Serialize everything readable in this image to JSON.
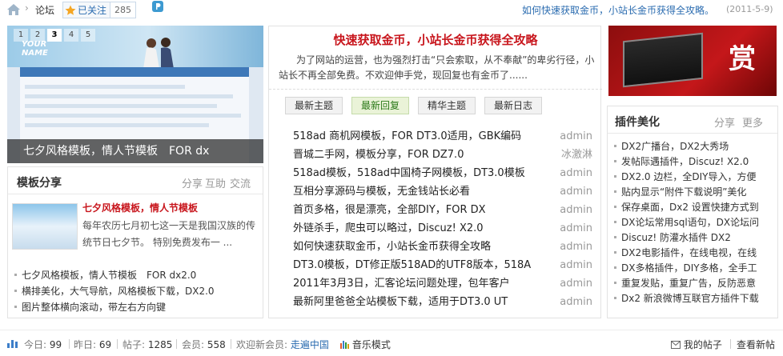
{
  "topbar": {
    "breadcrumb": "论坛",
    "follow_label": "已关注",
    "follow_count": "285",
    "headline_link": "如何快速获取金币，小站长金币获得全攻略。",
    "headline_date": "(2011-5-9)"
  },
  "slideshow": {
    "pages": [
      "1",
      "2",
      "3",
      "4",
      "5"
    ],
    "active_page": "3",
    "caption": "七夕风格模板，情人节模板　FOR dx",
    "logo_text": "YOUR NAME"
  },
  "template_share": {
    "title": "模板分享",
    "tabs": [
      "分享",
      "互助",
      "交流"
    ],
    "feature_title": "七夕风格模板，情人节模板",
    "feature_desc": "每年农历七月初七这一天是我国汉族的传统节日七夕节。 特别免费发布一 ...",
    "items": [
      "七夕风格模板，情人节模板　FOR dx2.0",
      "横排美化，大气导航，风格模板下载，DX2.0",
      "图片整体横向滚动，带左右方向键"
    ]
  },
  "article": {
    "title": "快速获取金币，小站长金币获得全攻略",
    "desc": "为了网站的运营，也为强烈打击“只会索取，从不奉献”的卑劣行径，小站长不再全部免费。不欢迎伸手党，现回复也有金币了......",
    "tabs": [
      "最新主题",
      "最新回复",
      "精华主题",
      "最新日志"
    ],
    "active_tab": "最新回复",
    "threads": [
      {
        "title": "518ad 商机网模板，FOR DT3.0适用，GBK编码",
        "author": "admin"
      },
      {
        "title": "晋城二手网，模板分享，FOR DZ7.0",
        "author": "冰激淋"
      },
      {
        "title": "518ad模板，518ad中国椅子网模板，DT3.0模板",
        "author": "admin"
      },
      {
        "title": "互相分享源码与模板，无金钱站长必看",
        "author": "admin"
      },
      {
        "title": "首页多格，很是漂亮，全部DIY，FOR DX",
        "author": "admin"
      },
      {
        "title": "外链杀手，爬虫可以略过，Discuz! X2.0",
        "author": "admin"
      },
      {
        "title": "如何快速获取金币，小站长金币获得全攻略",
        "author": "admin"
      },
      {
        "title": "DT3.0模板，DT修正版518AD的UTF8版本，518A",
        "author": "admin"
      },
      {
        "title": "2011年3月3日，汇客论坛问题处理，包年客户",
        "author": "admin"
      },
      {
        "title": "最新阿里爸爸全站模板下载，适用于DT3.0 UT",
        "author": "admin"
      }
    ]
  },
  "ad": {
    "text": "赏"
  },
  "plugins": {
    "title": "插件美化",
    "tabs": [
      "分享",
      "更多"
    ],
    "items": [
      "DX2广播台，DX2大秀场",
      "发帖际遇插件，Discuz! X2.0",
      "DX2.0 边栏，全DIY导入，方便",
      "贴内显示“附件下载说明”美化",
      "保存桌面，Dx2 设置快捷方式到",
      "DX论坛常用sql语句，DX论坛问",
      "Discuz! 防灌水插件 DX2",
      "DX2电影插件，在线电视，在线",
      "DX多格插件，DIY多格，全手工",
      "重复发贴，重复广告，反防恶意",
      "Dx2 新浪微博互联官方插件下载"
    ]
  },
  "stats": {
    "today_label": "今日:",
    "today": "99",
    "yesterday_label": "昨日:",
    "yesterday": "69",
    "posts_label": "帖子:",
    "posts": "1285",
    "members_label": "会员:",
    "members": "558",
    "welcome_label": "欢迎新会员:",
    "new_member": "走遍中国",
    "music_mode": "音乐模式",
    "my_posts": "我的帖子",
    "view_new": "查看新帖"
  },
  "colors": {
    "link_blue": "#2b6cb0",
    "title_red": "#c8161d",
    "active_tab_green": "#2c7a1a"
  }
}
